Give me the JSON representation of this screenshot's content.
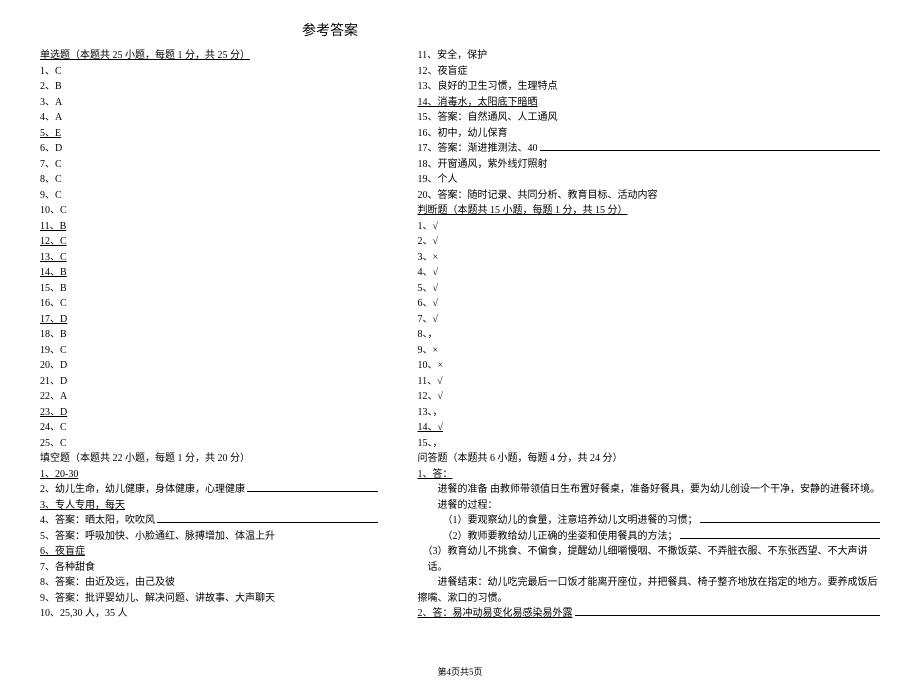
{
  "title": "参考答案",
  "footer": "第4页共5页",
  "col1": {
    "mc_header": "单选题（本题共 25 小题，每题 1 分，共 25 分）",
    "mc": [
      {
        "n": "1",
        "a": "C",
        "u": false
      },
      {
        "n": "2",
        "a": "B",
        "u": false
      },
      {
        "n": "3",
        "a": "A",
        "u": false
      },
      {
        "n": "4",
        "a": "A",
        "u": false
      },
      {
        "n": "5",
        "a": "E",
        "u": true
      },
      {
        "n": "6",
        "a": "D",
        "u": false
      },
      {
        "n": "7",
        "a": "C",
        "u": false
      },
      {
        "n": "8",
        "a": "C",
        "u": false
      },
      {
        "n": "9",
        "a": "C",
        "u": false
      },
      {
        "n": "10",
        "a": "C",
        "u": false
      },
      {
        "n": "11",
        "a": "B",
        "u": true
      },
      {
        "n": "12",
        "a": "C",
        "u": true
      },
      {
        "n": "13",
        "a": "C",
        "u": true
      },
      {
        "n": "14",
        "a": "B",
        "u": true
      },
      {
        "n": "15",
        "a": "B",
        "u": false
      },
      {
        "n": "16",
        "a": "C",
        "u": false
      },
      {
        "n": "17",
        "a": "D",
        "u": true
      },
      {
        "n": "18",
        "a": "B",
        "u": false
      },
      {
        "n": "19",
        "a": "C",
        "u": false
      },
      {
        "n": "20",
        "a": "D",
        "u": false
      },
      {
        "n": "21",
        "a": "D",
        "u": false
      },
      {
        "n": "22",
        "a": "A",
        "u": false
      },
      {
        "n": "23",
        "a": "D",
        "u": true
      },
      {
        "n": "24",
        "a": "C",
        "u": false
      },
      {
        "n": "25",
        "a": "C",
        "u": false
      }
    ],
    "fill_header": "填空题（本题共 22 小题，每题 1 分，共 20 分）",
    "fill": [
      {
        "n": "1",
        "t": "20-30",
        "u": true,
        "rule": false
      },
      {
        "n": "2",
        "t": "幼儿生命，幼儿健康，身体健康，心理健康",
        "u": false,
        "rule": true
      },
      {
        "n": "3",
        "t": "专人专用，每天",
        "u": true,
        "rule": false
      },
      {
        "n": "4",
        "t": "答案：晒太阳，吹吹风",
        "u": false,
        "rule": true
      },
      {
        "n": "5",
        "t": "答案：呼吸加快、小脸通红、脉搏增加、体温上升",
        "u": false,
        "rule": false
      },
      {
        "n": "6",
        "t": "夜盲症",
        "u": true,
        "rule": false
      },
      {
        "n": "7",
        "t": "各种甜食",
        "u": false,
        "rule": false
      },
      {
        "n": "8",
        "t": "答案：由近及远，由己及彼",
        "u": false,
        "rule": false
      },
      {
        "n": "9",
        "t": "答案：批评婴幼儿、解决问题、讲故事、大声聊天",
        "u": false,
        "rule": false
      },
      {
        "n": "10",
        "t": "25,30 人，35 人",
        "u": false,
        "rule": false
      }
    ]
  },
  "col2": {
    "fill2": [
      {
        "n": "11",
        "t": "安全，保护",
        "u": false,
        "rule": false
      },
      {
        "n": "12",
        "t": "夜盲症",
        "u": false,
        "rule": false
      },
      {
        "n": "13",
        "t": "良好的卫生习惯，生理特点",
        "u": false,
        "rule": false
      },
      {
        "n": "14",
        "t": "消毒水，太阳底下暗晒",
        "u": true,
        "rule": false
      },
      {
        "n": "15",
        "t": "答案：自然通风、人工通风",
        "u": false,
        "rule": false
      },
      {
        "n": "16",
        "t": "初中，幼儿保育",
        "u": false,
        "rule": false
      },
      {
        "n": "17",
        "t": "答案：渐进推测法、40",
        "u": false,
        "rule": true
      },
      {
        "n": "18",
        "t": "开窗通风，紫外线灯照射",
        "u": false,
        "rule": false
      },
      {
        "n": "19",
        "t": "个人",
        "u": false,
        "rule": false
      },
      {
        "n": "20",
        "t": "答案：随时记录、共同分析、教育目标、活动内容",
        "u": false,
        "rule": false
      }
    ],
    "judge_header": "判断题（本题共 15 小题，每题 1 分，共 15 分）",
    "judge": [
      {
        "n": "1",
        "a": "√",
        "u": false
      },
      {
        "n": "2",
        "a": "√",
        "u": false
      },
      {
        "n": "3",
        "a": "×",
        "u": false
      },
      {
        "n": "4",
        "a": "√",
        "u": false
      },
      {
        "n": "5",
        "a": "√",
        "u": false
      },
      {
        "n": "6",
        "a": "√",
        "u": false
      },
      {
        "n": "7",
        "a": "√",
        "u": false
      },
      {
        "n": "8",
        "a": "，",
        "u": false
      },
      {
        "n": "9",
        "a": "×",
        "u": false
      },
      {
        "n": "10",
        "a": "×",
        "u": false
      },
      {
        "n": "11",
        "a": "√",
        "u": false
      },
      {
        "n": "12",
        "a": "√",
        "u": false
      },
      {
        "n": "13",
        "a": "，",
        "u": false
      },
      {
        "n": "14",
        "a": "√",
        "u": true
      },
      {
        "n": "15",
        "a": "，",
        "u": false
      }
    ],
    "qa_header": "问答题（本题共 6 小题，每题 4 分，共 24 分）",
    "qa": [
      {
        "t": "1、答：",
        "u": true,
        "rule": false,
        "cls": ""
      },
      {
        "t": "进餐的准备 由教师带领值日生布置好餐桌，准备好餐具，要为幼儿创设一个干净，安静的进餐环境。",
        "u": false,
        "rule": false,
        "cls": "indent"
      },
      {
        "t": "进餐的过程：",
        "u": false,
        "rule": false,
        "cls": "indent"
      },
      {
        "t": "（1）要观察幼儿的食量，注意培养幼儿文明进餐的习惯；",
        "u": false,
        "rule": true,
        "cls": "indent2"
      },
      {
        "t": "（2）教师要教给幼儿正确的坐姿和使用餐具的方法；",
        "u": false,
        "rule": true,
        "cls": "indent2"
      },
      {
        "t": "（3）教育幼儿不挑食、不偏食，提醒幼儿细嚼慢咽、不撒饭菜、不弄脏衣服、不东张西望、不大声讲",
        "u": false,
        "rule": false,
        "cls": "hang"
      },
      {
        "t": "话。",
        "u": false,
        "rule": false,
        "cls": "indenthalf"
      },
      {
        "t": "进餐结束：幼儿吃完最后一口饭才能离开座位，并把餐具、椅子整齐地放在指定的地方。要养成饭后",
        "u": false,
        "rule": false,
        "cls": "indent"
      },
      {
        "t": "擦嘴、漱口的习惯。",
        "u": false,
        "rule": false,
        "cls": ""
      },
      {
        "t": "2、答：易冲动易变化易感染易外露",
        "u": true,
        "rule": true,
        "cls": ""
      }
    ]
  }
}
